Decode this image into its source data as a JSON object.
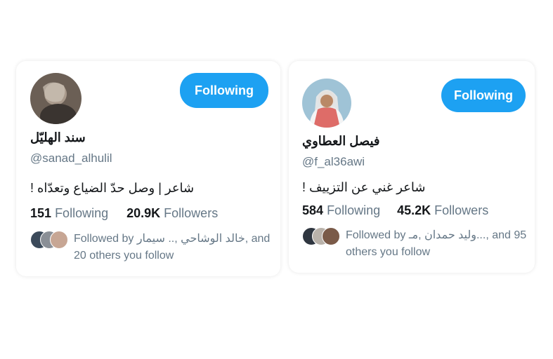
{
  "cards": [
    {
      "name": "سند الهليّل",
      "handle": "@sanad_alhulil",
      "bio": "شاعر | وصل حدّ الضياع وتعدّاه !",
      "following_count": "151",
      "following_label": "Following",
      "followers_count": "20.9K",
      "followers_label": "Followers",
      "button_label": "Following",
      "followed_by_text": "Followed by خالد الوشاحي ,.. سيمار, and 20 others you follow"
    },
    {
      "name": "فيصل العطاوي",
      "handle": "@f_al36awi",
      "bio": "شاعر غني عن التزييف !",
      "following_count": "584",
      "following_label": "Following",
      "followers_count": "45.2K",
      "followers_label": "Followers",
      "button_label": "Following",
      "followed_by_text": "Followed by وليد حمدان ,مـ..., and 95 others you follow"
    }
  ],
  "colors": {
    "accent": "#1da1f2",
    "text_primary": "#14171a",
    "text_secondary": "#657786"
  }
}
